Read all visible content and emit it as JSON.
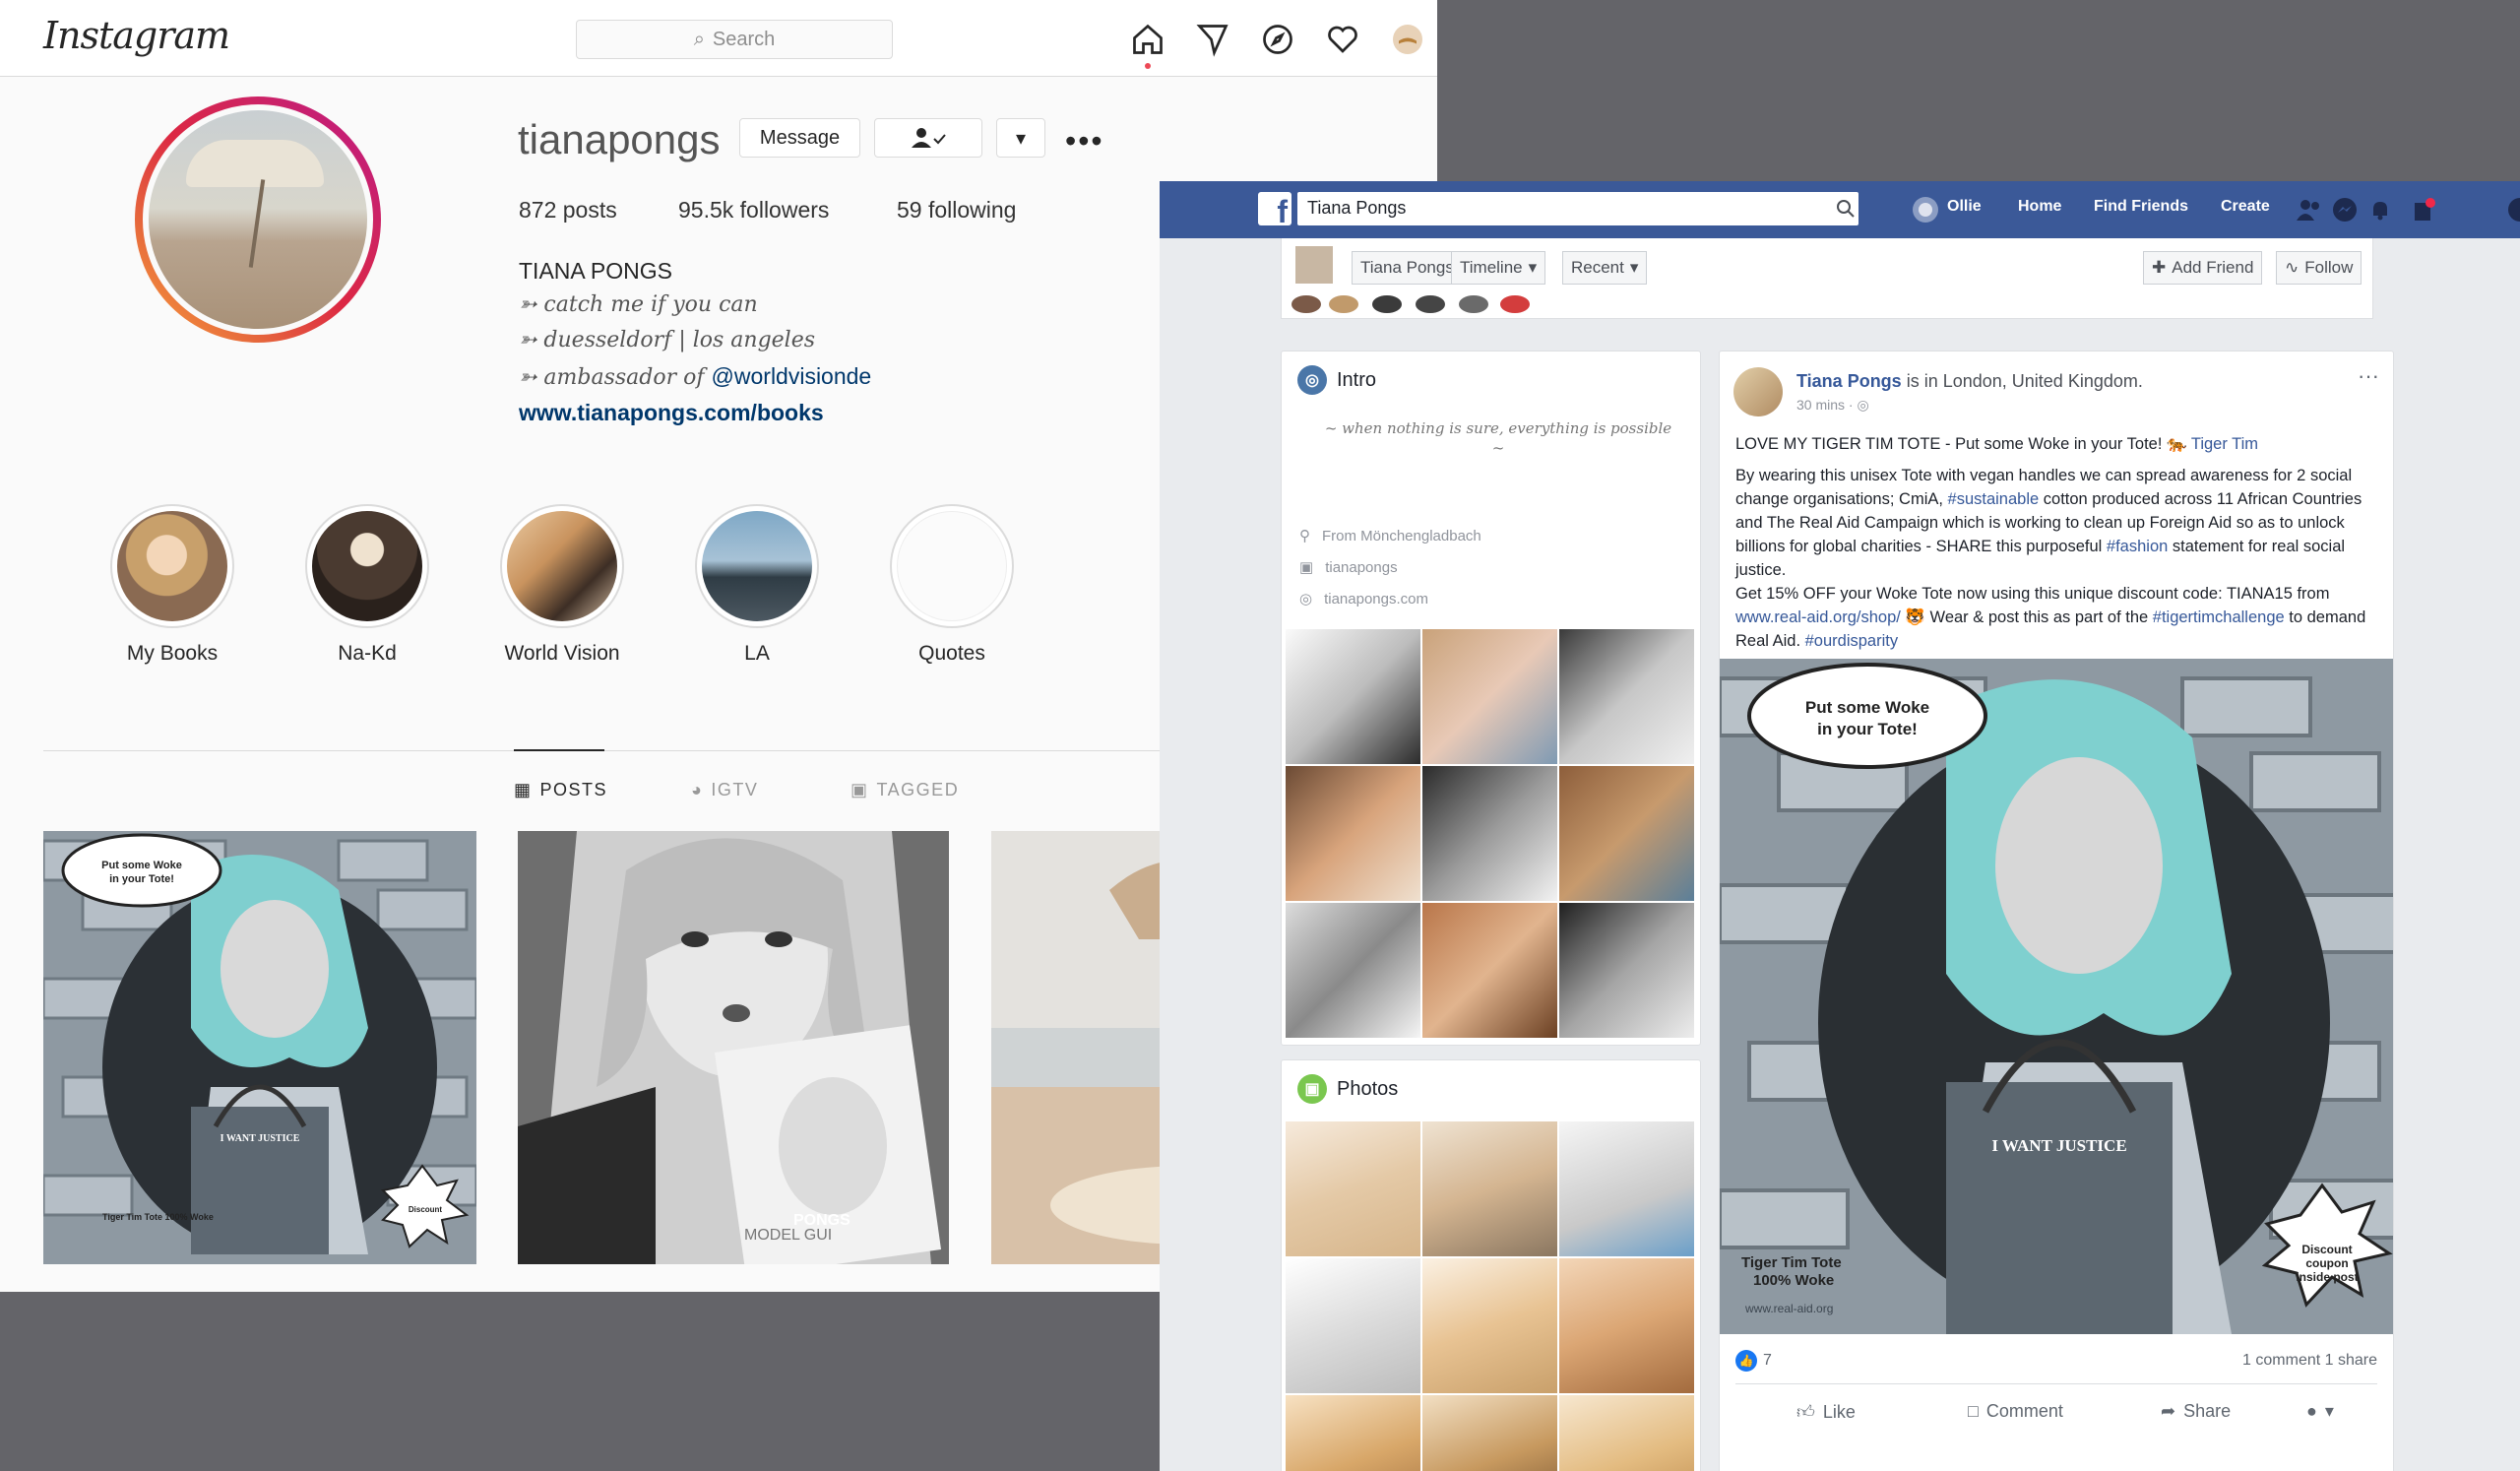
{
  "instagram": {
    "logo": "Instagram",
    "search_placeholder": "Search",
    "username": "tianapongs",
    "buttons": {
      "message": "Message",
      "follow_icon": "person-check-icon",
      "dropdown": "▾",
      "more": "•••"
    },
    "stats": {
      "posts": "872 posts",
      "followers": "95.5k followers",
      "following": "59 following"
    },
    "full_name": "TIANA PONGS",
    "bio": {
      "line1": "➳ catch me if you can",
      "line2": "➳ duesseldorf | los angeles",
      "line3_prefix": "➳ ambassador of ",
      "line3_mention": "@worldvisionde"
    },
    "website": "www.tianapongs.com/books",
    "highlights": [
      "My Books",
      "Na-Kd",
      "World Vision",
      "LA",
      "Quotes"
    ],
    "tabs": {
      "posts": "POSTS",
      "igtv": "IGTV",
      "tagged": "TAGGED"
    },
    "post_overlays": {
      "bubble": "Put some Woke in your Tote!",
      "bag": "I WANT JUSTICE",
      "tote": "Tiger Tim Tote 100% Woke",
      "coupon": "Discount coupon inside post",
      "model": "MODEL GUI",
      "brand": "PONGS"
    },
    "colors": {
      "link": "#00376b",
      "notification_dot": "#ed4956"
    }
  },
  "facebook": {
    "search_value": "Tiana Pongs",
    "nav": {
      "user": "Ollie",
      "home": "Home",
      "find_friends": "Find Friends",
      "create": "Create"
    },
    "cover_tabs": {
      "name": "Tiana Pongs",
      "timeline": "Timeline",
      "recent": "Recent",
      "add_friend": "Add Friend",
      "follow": "Follow"
    },
    "intro": {
      "title": "Intro",
      "quote": "~ when nothing is sure, everything is possible ~",
      "from": "From Mönchengladbach",
      "instagram": "tianapongs",
      "website": "tianapongs.com"
    },
    "photos_title": "Photos",
    "post": {
      "author": "Tiana Pongs",
      "location_text": " is in London, United Kingdom.",
      "time": "30 mins · ",
      "line1": "LOVE MY TIGER TIM TOTE - Put some Woke in your Tote! 🐅 ",
      "line1_tag": "Tiger Tim",
      "p1_a": "By wearing this unisex Tote with vegan handles we can spread awareness for 2 social change organisations; CmiA, ",
      "p1_tag": "#sustainable",
      "p1_b": " cotton produced across 11 African Countries and The Real Aid Campaign which is working to clean up Foreign Aid so as to unlock billions for global charities - SHARE this purposeful ",
      "p1_tag2": "#fashion",
      "p1_c": " statement for real social justice.",
      "p2_a": "Get 15% OFF your Woke Tote now using this unique discount code: TIANA15 from ",
      "p2_link": "www.real-aid.org/shop/",
      "p2_b": " 🐯 Wear & post this as part of the ",
      "p2_tag": "#tigertimchallenge",
      "p2_c": " to demand Real Aid. ",
      "p2_tag2": "#ourdisparity",
      "image_bubble": "Put some Woke in your Tote!",
      "image_bag": "I WANT JUSTICE",
      "image_tote": "Tiger Tim Tote 100% Woke",
      "image_url": "www.real-aid.org",
      "image_coupon": "Discount coupon inside post",
      "reactions": "7",
      "counts": "1 comment  1 share",
      "actions": {
        "like": "Like",
        "comment": "Comment",
        "share": "Share"
      }
    },
    "colors": {
      "bar": "#3b5998",
      "link": "#365899"
    }
  }
}
